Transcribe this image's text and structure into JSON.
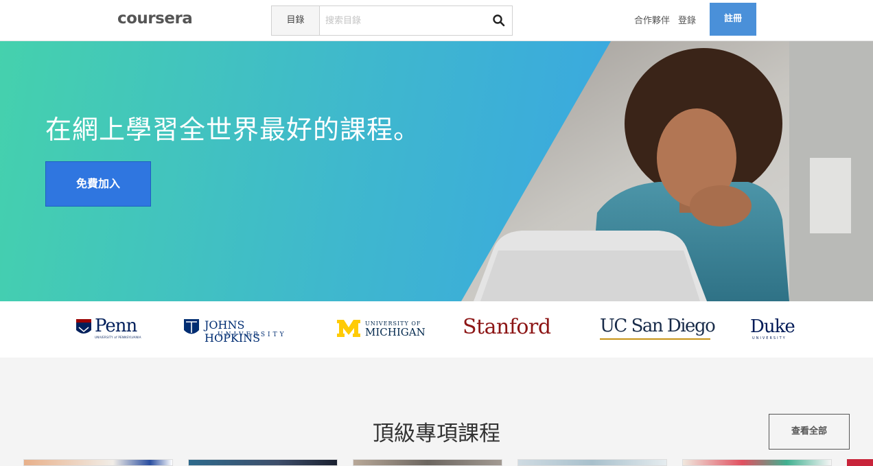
{
  "header": {
    "logo": "coursera",
    "search_category": "目錄",
    "search_placeholder": "搜索目錄",
    "partner_link": "合作夥伴",
    "login_link": "登錄",
    "signup_button": "註冊"
  },
  "hero": {
    "title": "在網上學習全世界最好的課程。",
    "join_button": "免費加入"
  },
  "partners": {
    "penn": "Penn",
    "penn_sub": "UNIVERSITY of PENNSYLVANIA",
    "jhu": "JOHNS HOPKINS",
    "jhu_sub": "UNIVERSITY",
    "umich_top": "UNIVERSITY OF",
    "umich": "MICHIGAN",
    "stanford": "Stanford",
    "ucsd": "UC San Diego",
    "duke": "Duke",
    "duke_sub": "UNIVERSITY"
  },
  "section": {
    "title": "頂級專項課程",
    "view_all": "查看全部"
  },
  "colors": {
    "accent": "#4a90d9",
    "join": "#2f76e0",
    "stanford": "#8c1515",
    "ucsd": "#182b49",
    "duke": "#001a57",
    "michigan_gold": "#ffcb05"
  }
}
